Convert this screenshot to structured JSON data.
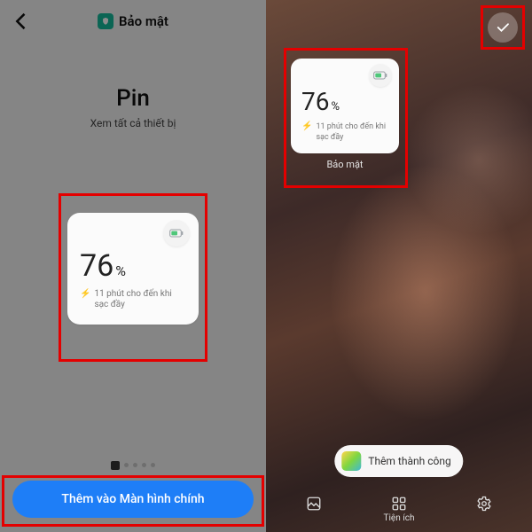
{
  "left": {
    "header": {
      "appName": "Bảo mật"
    },
    "pageTitle": "Pin",
    "subtitle": "Xem tất cả thiết bị",
    "widget": {
      "percent": "76",
      "percentSign": "%",
      "chargeText": "11 phút cho đến khi sạc đầy"
    },
    "addButton": "Thêm vào Màn hình chính"
  },
  "right": {
    "widget": {
      "percent": "76",
      "percentSign": "%",
      "chargeText": "11 phút cho đến khi sạc đầy",
      "label": "Bảo mật"
    },
    "toast": "Thêm thành công",
    "bottomBar": {
      "widgets": "Tiện ích"
    }
  }
}
